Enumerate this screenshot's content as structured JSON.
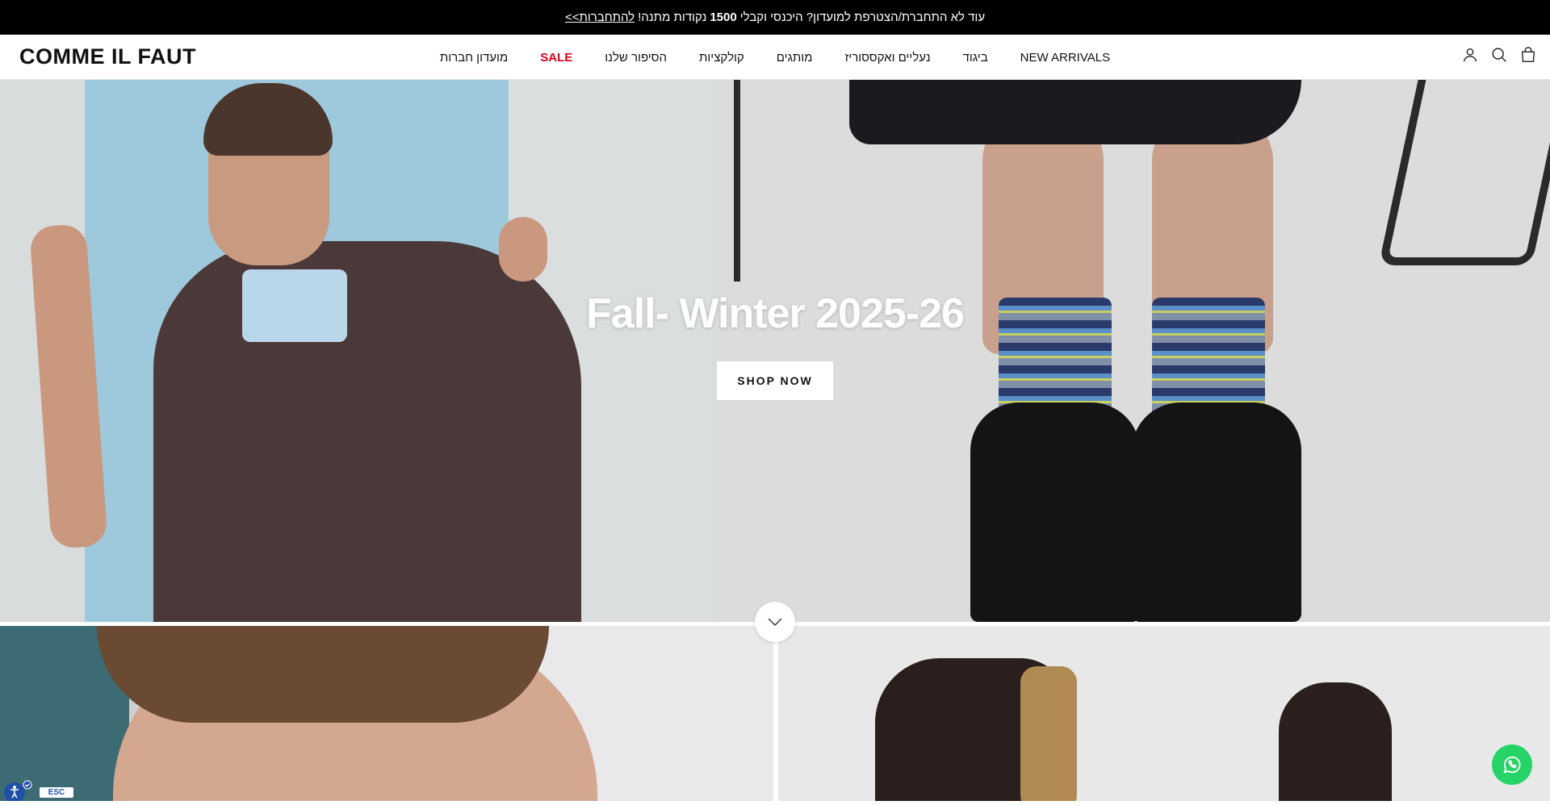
{
  "announcement": {
    "text": "עוד לא התחברת/הצטרפת למועדון? היכנסי וקבלי",
    "points": "1500",
    "text2": "נקודות מתנה!",
    "link": "להתחברות>>"
  },
  "header": {
    "logo": "COMME IL FAUT",
    "nav": [
      {
        "label": "מועדון חברות"
      },
      {
        "label": "SALE"
      },
      {
        "label": "הסיפור שלנו"
      },
      {
        "label": "קולקציות"
      },
      {
        "label": "מותגים"
      },
      {
        "label": "נעליים ואקססוריז"
      },
      {
        "label": "ביגוד"
      },
      {
        "label": "NEW ARRIVALS"
      }
    ],
    "icons": [
      "account-icon",
      "search-icon",
      "cart-icon"
    ]
  },
  "hero": {
    "title": "Fall- Winter 2025-26",
    "button": "SHOP NOW"
  },
  "widgets": {
    "esc": "ESC"
  },
  "colors": {
    "sale": "#e0001b",
    "whatsapp": "#25d366",
    "announcement_bg": "#000000"
  }
}
